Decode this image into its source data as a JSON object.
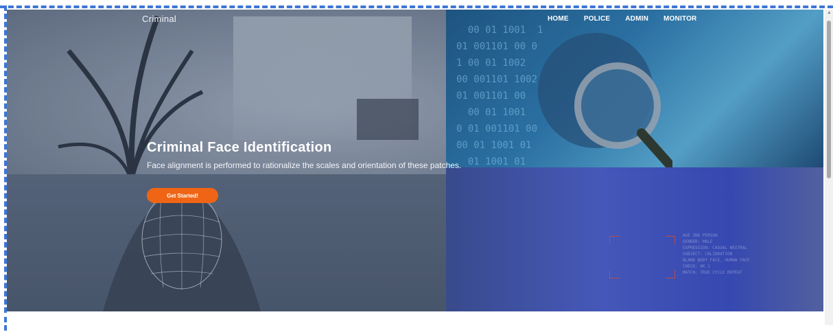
{
  "navbar": {
    "brand": "Criminal",
    "links": [
      "HOME",
      "POLICE",
      "ADMIN",
      "MONITOR"
    ]
  },
  "hero": {
    "title": "Criminal Face Identification",
    "subtitle": "Face alignment is performed to rationalize the scales and orientation of these patches.",
    "cta_label": "Get Started!"
  },
  "colors": {
    "accent": "#f06515",
    "frame": "#3f76d6"
  }
}
